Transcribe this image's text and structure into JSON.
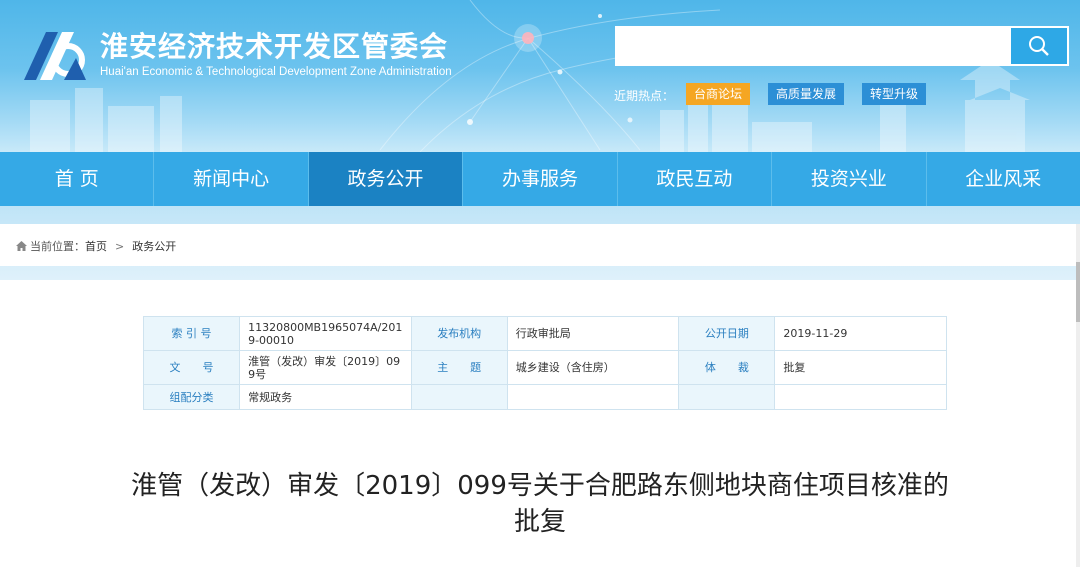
{
  "header": {
    "title_cn": "淮安经济技术开发区管委会",
    "title_en": "Huai'an Economic & Technological Development Zone Administration",
    "search": {
      "value": "",
      "placeholder": ""
    },
    "hot_label": "近期热点：",
    "hot_tags": [
      {
        "label": "台商论坛",
        "color": "#f5a623"
      },
      {
        "label": "高质量发展",
        "color": "#2c8fd6"
      },
      {
        "label": "转型升级",
        "color": "#2c8fd6"
      }
    ]
  },
  "nav": {
    "items": [
      {
        "label": "首 页"
      },
      {
        "label": "新闻中心"
      },
      {
        "label": "政务公开",
        "active": true
      },
      {
        "label": "办事服务"
      },
      {
        "label": "政民互动"
      },
      {
        "label": "投资兴业"
      },
      {
        "label": "企业风采"
      }
    ]
  },
  "breadcrumb": {
    "prefix": "当前位置：",
    "home": "首页",
    "separator": ">",
    "current": "政务公开"
  },
  "meta": {
    "index_label": "索 引 号",
    "index_value": "11320800MB1965074A/2019-00010",
    "publisher_label": "发布机构",
    "publisher_value": "行政审批局",
    "date_label": "公开日期",
    "date_value": "2019-11-29",
    "docno_label": "文　　号",
    "docno_value": "淮管（发改）审发〔2019〕099号",
    "topic_label": "主　　题",
    "topic_value": "城乡建设（含住房）",
    "genre_label": "体　　裁",
    "genre_value": "批复",
    "category_label": "组配分类",
    "category_value": "常规政务"
  },
  "document": {
    "title": "淮管（发改）审发〔2019〕099号关于合肥路东侧地块商住项目核准的批复"
  },
  "colors": {
    "nav_bg": "#35a9e6",
    "nav_active": "#1b82c3",
    "accent": "#2ea8e6",
    "hot_orange": "#f5a623"
  }
}
